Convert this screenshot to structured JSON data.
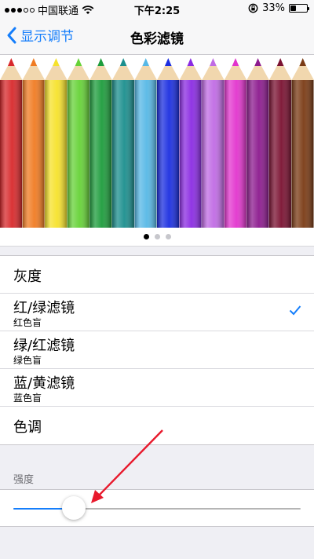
{
  "status_bar": {
    "carrier": "中国联通",
    "time": "下午2:25",
    "battery_text": "33%",
    "signal_filled": 3,
    "signal_total": 5,
    "battery_level": 0.33
  },
  "nav": {
    "back_label": "显示调节",
    "title": "色彩滤镜"
  },
  "preview": {
    "pencil_colors": [
      "#d8282b",
      "#f07b22",
      "#f6e22b",
      "#66d237",
      "#1d9c3c",
      "#1b8f8e",
      "#56b8e6",
      "#1b2ee0",
      "#8a2be2",
      "#c06be4",
      "#e234ce",
      "#8c1a8e",
      "#7a1131",
      "#7a3a14"
    ],
    "page_count": 3,
    "current_page": 1
  },
  "filters": [
    {
      "label": "灰度",
      "sub": "",
      "checked": false
    },
    {
      "label": "红/绿滤镜",
      "sub": "红色盲",
      "checked": true
    },
    {
      "label": "绿/红滤镜",
      "sub": "绿色盲",
      "checked": false
    },
    {
      "label": "蓝/黄滤镜",
      "sub": "蓝色盲",
      "checked": false
    },
    {
      "label": "色调",
      "sub": "",
      "checked": false
    }
  ],
  "intensity": {
    "section_title": "强度",
    "value": 0.21
  },
  "colors": {
    "accent": "#157efb",
    "annotation": "#e8192c"
  }
}
